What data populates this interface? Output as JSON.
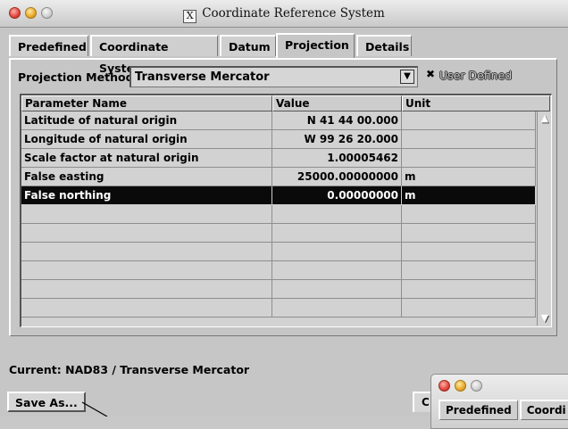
{
  "window": {
    "title": "Coordinate Reference System",
    "title_icon_glyph": "X"
  },
  "tabs": [
    {
      "label": "Predefined",
      "active": false
    },
    {
      "label": "Coordinate System",
      "active": false
    },
    {
      "label": "Datum",
      "active": false
    },
    {
      "label": "Projection",
      "active": true
    },
    {
      "label": "Details",
      "active": false
    }
  ],
  "projection": {
    "method_label": "Projection Method",
    "method_value": "Transverse Mercator",
    "dropdown_glyph": "▼",
    "user_defined_label": "User Defined",
    "user_defined_checked": true,
    "check_glyph": "✖"
  },
  "table": {
    "headers": [
      "Parameter Name",
      "Value",
      "Unit"
    ],
    "rows": [
      {
        "name": "Latitude of natural origin",
        "value": "N 41 44 00.000",
        "unit": ""
      },
      {
        "name": "Longitude of natural origin",
        "value": "W 99 26 20.000",
        "unit": ""
      },
      {
        "name": "Scale factor at natural origin",
        "value": "1.00005462",
        "unit": ""
      },
      {
        "name": "False easting",
        "value": "25000.00000000",
        "unit": "m"
      },
      {
        "name": "False northing",
        "value": "0.00000000",
        "unit": "m",
        "selected": true
      },
      {
        "name": "",
        "value": "",
        "unit": ""
      },
      {
        "name": "",
        "value": "",
        "unit": ""
      },
      {
        "name": "",
        "value": "",
        "unit": ""
      },
      {
        "name": "",
        "value": "",
        "unit": ""
      },
      {
        "name": "",
        "value": "",
        "unit": ""
      },
      {
        "name": "",
        "value": "",
        "unit": ""
      }
    ],
    "scroll_up_glyph": "▲",
    "scroll_down_glyph": "▼"
  },
  "status": {
    "current_text": "Current: NAD83 / Transverse Mercator"
  },
  "buttons": {
    "save_as": "Save As...",
    "cancel_partial": "C"
  },
  "secondary_window": {
    "tabs": [
      "Predefined",
      "Coordi"
    ]
  },
  "colors": {
    "selection_bg": "#0a0a0a",
    "window_bg": "#c6c6c6"
  }
}
